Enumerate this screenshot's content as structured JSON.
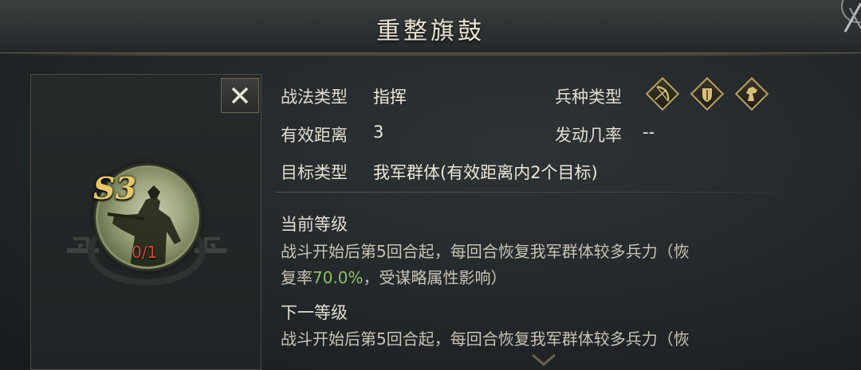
{
  "title": "重整旗鼓",
  "skill": {
    "grade": "S3",
    "level": "0/1",
    "type_label": "战法类型",
    "type_value": "指挥",
    "range_label": "有效距离",
    "range_value": "3",
    "target_label": "目标类型",
    "target_value": "我军群体(有效距离内2个目标)",
    "arm_label": "兵种类型",
    "arm_icons": [
      "bow-icon",
      "shield-icon",
      "horse-icon"
    ],
    "chance_label": "发动几率",
    "chance_value": "--"
  },
  "current": {
    "heading": "当前等级",
    "line1": "战斗开始后第5回合起，每回合恢复我军群体较多兵力（恢",
    "line2_pre": "复率",
    "line2_highlight": "70.0%",
    "line2_post": "，受谋略属性影响）"
  },
  "next": {
    "heading": "下一等级",
    "line1": "战斗开始后第5回合起，每回合恢复我军群体较多兵力（恢"
  },
  "colors": {
    "highlight": "#8fc05e",
    "level": "#d0473a",
    "grade": "#e6c76a",
    "accent_gold": "#b9a062"
  }
}
